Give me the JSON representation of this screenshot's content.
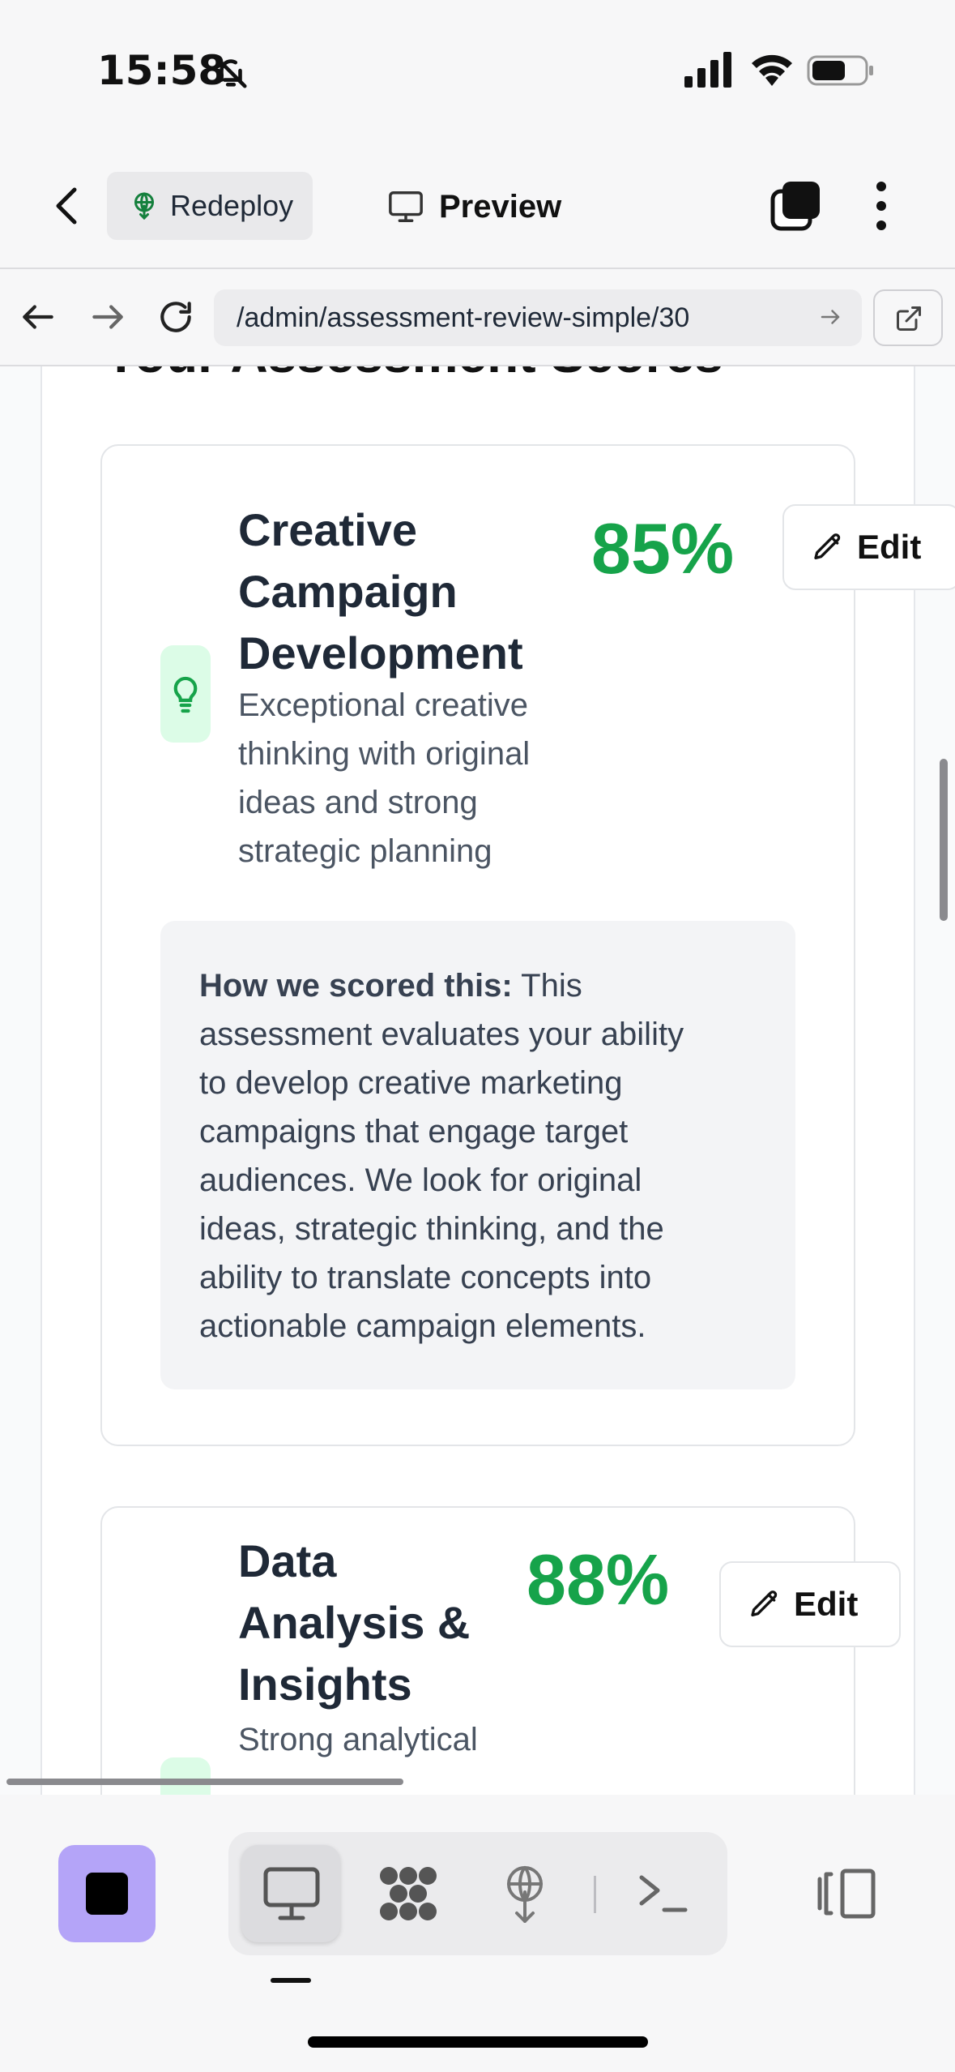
{
  "status_bar": {
    "time": "15:58",
    "icons": [
      "bell-off-icon",
      "cellular-signal-icon",
      "wifi-icon",
      "battery-icon"
    ]
  },
  "app_header": {
    "redeploy_label": "Redeploy",
    "preview_label": "Preview",
    "icons": [
      "back-chevron-icon",
      "redeploy-icon",
      "monitor-icon",
      "tabs-icon",
      "more-vertical-icon"
    ]
  },
  "url_bar": {
    "url": "/admin/assessment-review-simple/30",
    "icons": [
      "back-arrow-icon",
      "forward-arrow-icon",
      "reload-icon",
      "go-arrow-icon",
      "open-external-icon"
    ]
  },
  "page": {
    "section_title": "Your Assessment Scores",
    "cards": [
      {
        "title_lines": [
          "Creative",
          "Campaign",
          "Development"
        ],
        "description_lines": [
          "Exceptional creative",
          "thinking with original",
          "ideas and strong",
          "strategic planning"
        ],
        "score": "85%",
        "edit_label": "Edit",
        "icon": "lightbulb-icon",
        "scored_heading": "How we scored this:",
        "scored_text_first": " This",
        "scored_lines": [
          "assessment evaluates your ability",
          "to develop creative marketing",
          "campaigns that engage target",
          "audiences. We look for original",
          "ideas, strategic thinking, and the",
          "ability to translate concepts into",
          "actionable campaign elements."
        ]
      },
      {
        "title_lines": [
          "Data",
          "Analysis &",
          "Insights"
        ],
        "description_lines": [
          "Strong analytical"
        ],
        "score": "88%",
        "edit_label": "Edit",
        "icon": "chart-icon"
      }
    ]
  },
  "colors": {
    "score_green": "#16a34a",
    "icon_bg_green": "#dcfce7",
    "stop_button": "#b4a4f8",
    "background": "#f7f7f8"
  },
  "bottom_toolbar": {
    "icons": [
      "stop-icon",
      "desktop-preview-icon",
      "workflow-icon",
      "deploy-icon",
      "terminal-icon",
      "split-view-icon"
    ]
  }
}
